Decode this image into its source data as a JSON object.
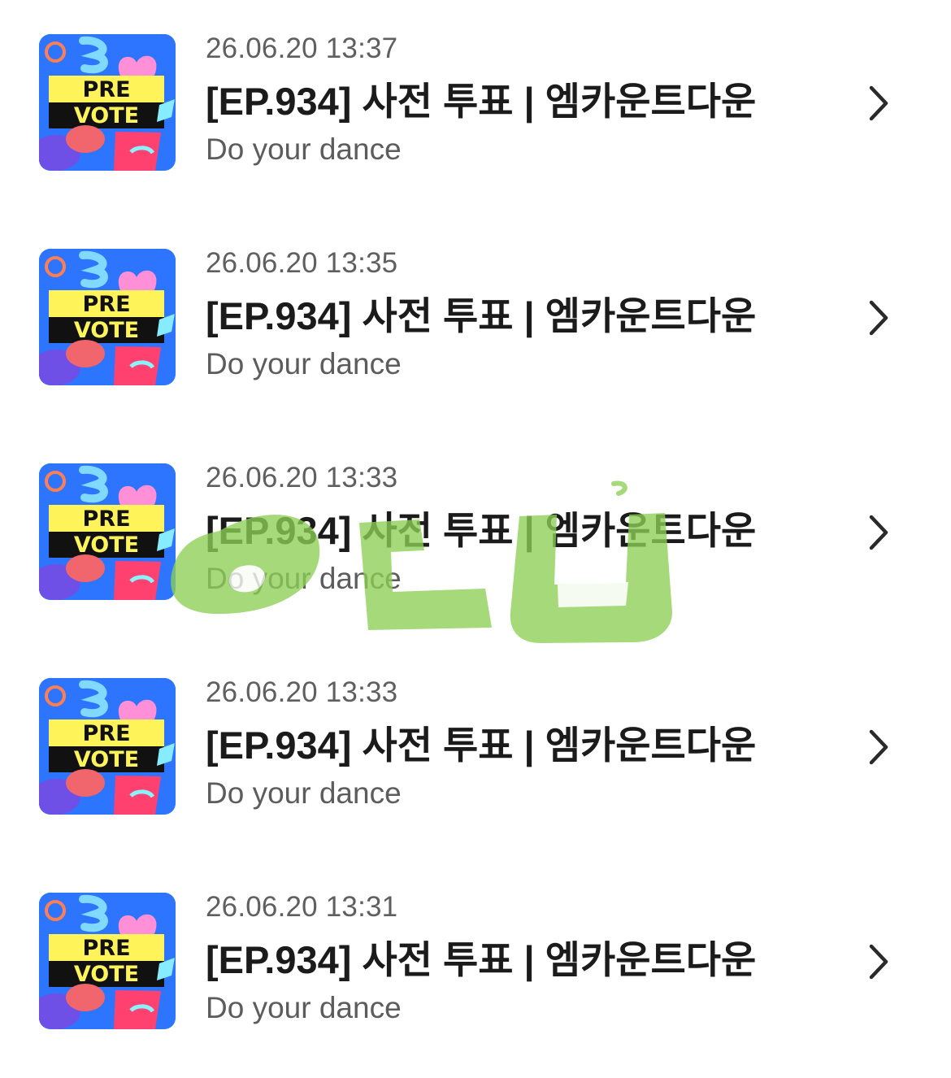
{
  "notifications": [
    {
      "thumbnail": {
        "line1": "PRE",
        "line2": "VOTE"
      },
      "date": "26.06.20 13:37",
      "title": "[EP.934] 사전 투표 | 엠카운트다운",
      "subtitle": "Do your dance",
      "chevron_icon": "chevron-right-icon"
    },
    {
      "thumbnail": {
        "line1": "PRE",
        "line2": "VOTE"
      },
      "date": "26.06.20 13:35",
      "title": "[EP.934] 사전 투표 | 엠카운트다운",
      "subtitle": "Do your dance",
      "chevron_icon": "chevron-right-icon"
    },
    {
      "thumbnail": {
        "line1": "PRE",
        "line2": "VOTE"
      },
      "date": "26.06.20 13:33",
      "title": "[EP.934] 사전 투표 | 엠카운트다운",
      "subtitle": "Do your dance",
      "chevron_icon": "chevron-right-icon"
    },
    {
      "thumbnail": {
        "line1": "PRE",
        "line2": "VOTE"
      },
      "date": "26.06.20 13:33",
      "title": "[EP.934] 사전 투표 | 엠카운트다운",
      "subtitle": "Do your dance",
      "chevron_icon": "chevron-right-icon"
    },
    {
      "thumbnail": {
        "line1": "PRE",
        "line2": "VOTE"
      },
      "date": "26.06.20 13:31",
      "title": "[EP.934] 사전 투표 | 엠카운트다운",
      "subtitle": "Do your dance",
      "chevron_icon": "chevron-right-icon"
    }
  ],
  "colors": {
    "date_text": "#5f5f5f",
    "title_text": "#1b1b1b",
    "subtitle_text": "#5c5c5c",
    "chevron": "#2a2a2a",
    "thumbnail_sky": "#2d74ff",
    "thumbnail_banner": "#fff35a",
    "thumbnail_dark_band": "#111111",
    "watermark_green": "#8ccf55"
  }
}
